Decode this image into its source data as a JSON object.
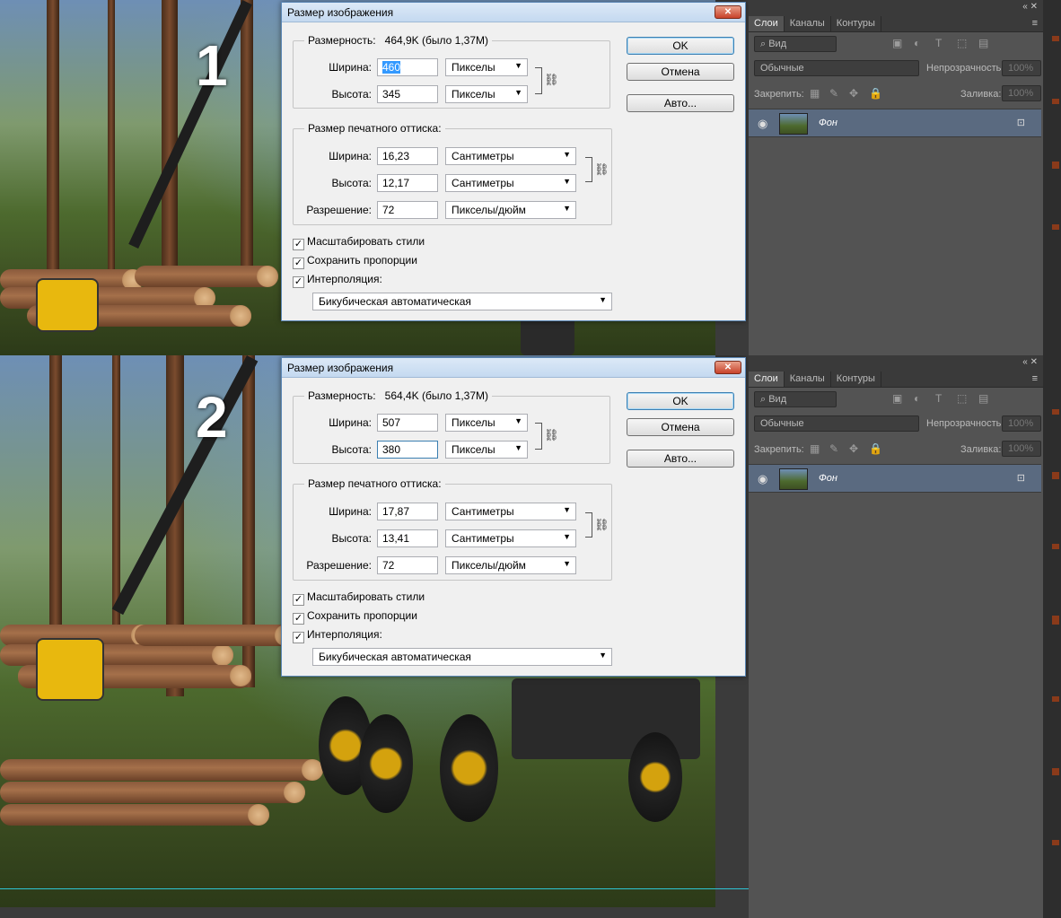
{
  "dialogs": [
    {
      "title": "Размер изображения",
      "close_label": "✕",
      "pixel_dims_label": "Размерность:",
      "pixel_dims_value": "464,9K (было 1,37M)",
      "width_label": "Ширина:",
      "width_value": "460",
      "width_unit": "Пикселы",
      "height_label": "Высота:",
      "height_value": "345",
      "height_unit": "Пикселы",
      "print_group_label": "Размер печатного оттиска:",
      "print_width_label": "Ширина:",
      "print_width_value": "16,23",
      "print_width_unit": "Сантиметры",
      "print_height_label": "Высота:",
      "print_height_value": "12,17",
      "print_height_unit": "Сантиметры",
      "resolution_label": "Разрешение:",
      "resolution_value": "72",
      "resolution_unit": "Пикселы/дюйм",
      "scale_styles_label": "Масштабировать стили",
      "constrain_label": "Сохранить пропорции",
      "resample_label": "Интерполяция:",
      "resample_value": "Бикубическая автоматическая",
      "ok_label": "OK",
      "cancel_label": "Отмена",
      "auto_label": "Авто..."
    },
    {
      "title": "Размер изображения",
      "close_label": "✕",
      "pixel_dims_label": "Размерность:",
      "pixel_dims_value": "564,4K (было 1,37M)",
      "width_label": "Ширина:",
      "width_value": "507",
      "width_unit": "Пикселы",
      "height_label": "Высота:",
      "height_value": "380",
      "height_unit": "Пикселы",
      "print_group_label": "Размер печатного оттиска:",
      "print_width_label": "Ширина:",
      "print_width_value": "17,87",
      "print_width_unit": "Сантиметры",
      "print_height_label": "Высота:",
      "print_height_value": "13,41",
      "print_height_unit": "Сантиметры",
      "resolution_label": "Разрешение:",
      "resolution_value": "72",
      "resolution_unit": "Пикселы/дюйм",
      "scale_styles_label": "Масштабировать стили",
      "constrain_label": "Сохранить пропорции",
      "resample_label": "Интерполяция:",
      "resample_value": "Бикубическая автоматическая",
      "ok_label": "OK",
      "cancel_label": "Отмена",
      "auto_label": "Авто..."
    }
  ],
  "step_labels": [
    "1",
    "2"
  ],
  "layers_panel": {
    "collapse_icon": "«",
    "close_icon": "✕",
    "menu_icon": "≡",
    "tabs": [
      "Слои",
      "Каналы",
      "Контуры"
    ],
    "filter_label": "Вид",
    "blend_mode": "Обычные",
    "opacity_label": "Непрозрачность:",
    "opacity_value": "100%",
    "lock_label": "Закрепить:",
    "fill_label": "Заливка:",
    "fill_value": "100%",
    "layer_name": "Фон"
  },
  "icons": {
    "checkbox_checked": "✓",
    "dropdown": "▼",
    "chain": "⛓",
    "eye": "👁",
    "lock": "🔒"
  }
}
